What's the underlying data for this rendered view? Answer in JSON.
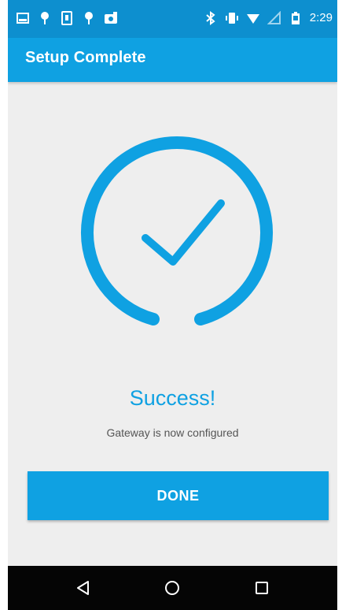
{
  "status_bar": {
    "time": "2:29",
    "left_icons": [
      "gallery-icon",
      "pin-icon",
      "sim-icon",
      "pin-icon",
      "photo-icon"
    ],
    "right_icons": [
      "bluetooth-icon",
      "vibrate-icon",
      "wifi-icon",
      "signal-icon",
      "battery-icon"
    ],
    "background": "#0d8fcf"
  },
  "app_bar": {
    "title": "Setup Complete",
    "background": "#0fa1e2"
  },
  "main": {
    "icon": "success-check-icon",
    "title": "Success!",
    "subtitle": "Gateway is now configured",
    "accent": "#0fa1e2"
  },
  "done_button": {
    "label": "DONE"
  },
  "nav_bar": {
    "buttons": [
      "back-icon",
      "home-icon",
      "recents-icon"
    ]
  }
}
